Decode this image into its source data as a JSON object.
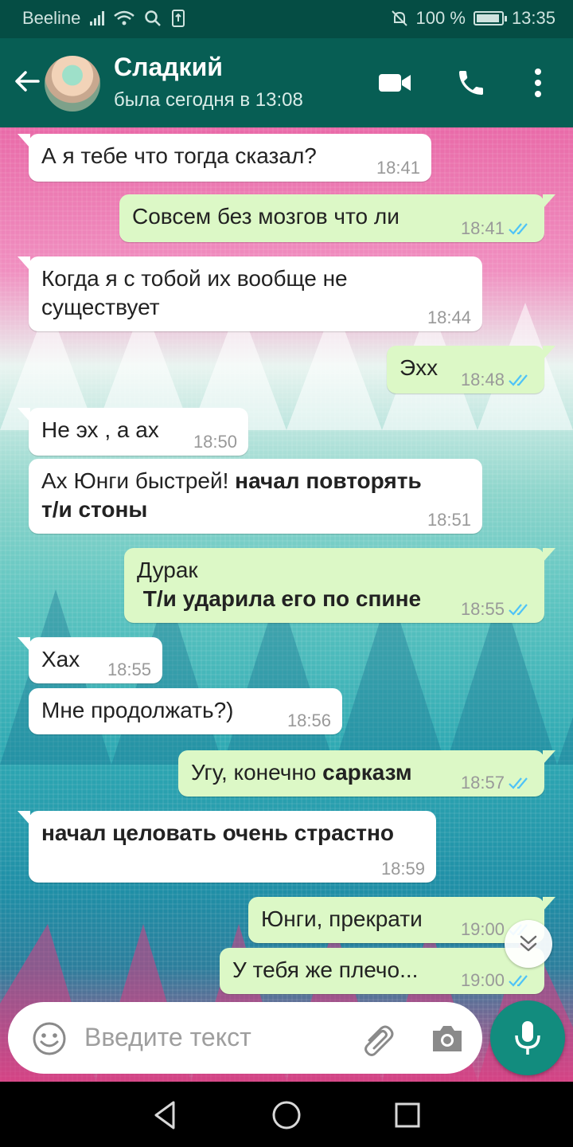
{
  "statusbar": {
    "carrier": "Beeline",
    "battery_text": "100 %",
    "time": "13:35",
    "icons": [
      "signal-icon",
      "wifi-icon",
      "search-icon",
      "sim-icon",
      "mute-icon",
      "battery-icon"
    ]
  },
  "header": {
    "name": "Сладкий",
    "last_seen": "была сегодня в 13:08",
    "icons": [
      "back-arrow-icon",
      "avatar",
      "video-call-icon",
      "phone-icon",
      "more-vert-icon"
    ]
  },
  "messages": [
    {
      "dir": "in",
      "text": "А я тебе что тогда сказал?",
      "time": "18:41"
    },
    {
      "dir": "out",
      "text": "Совсем без мозгов что ли",
      "time": "18:41",
      "read": true
    },
    {
      "dir": "in",
      "text_line1": "Когда я с тобой их вообще не",
      "text_line2": "существует",
      "time": "18:44"
    },
    {
      "dir": "out",
      "text": "Эхх",
      "time": "18:48",
      "read": true
    },
    {
      "dir": "in",
      "text": "Не эх , а ах",
      "time": "18:50"
    },
    {
      "dir": "in",
      "text_plain": "Ах Юнги быстрей! ",
      "text_bold_1": "начал повторять",
      "text_bold_2": "т/и стоны",
      "time": "18:51"
    },
    {
      "dir": "out",
      "text_line1": "Дурак",
      "text_bold": " Т/и ударила его по спине",
      "time": "18:55",
      "read": true
    },
    {
      "dir": "in",
      "text": "Хах",
      "time": "18:55"
    },
    {
      "dir": "in",
      "text": "Мне продолжать?)",
      "time": "18:56"
    },
    {
      "dir": "out",
      "text_plain": "Угу, конечно ",
      "text_bold": "сарказм",
      "time": "18:57",
      "read": true
    },
    {
      "dir": "in",
      "text_bold": "начал целовать очень страстно",
      "time": "18:59"
    },
    {
      "dir": "out",
      "text": "Юнги, прекрати",
      "time": "19:00",
      "read": true
    },
    {
      "dir": "out",
      "text": "У тебя же плечо...",
      "time": "19:00",
      "read": true
    }
  ],
  "input": {
    "placeholder": "Введите текст",
    "icons": [
      "emoji-icon",
      "attach-icon",
      "camera-icon",
      "mic-icon"
    ]
  },
  "colors": {
    "header": "#075e54",
    "statusbar": "#054d44",
    "outgoing_bubble": "#dcf8c6",
    "incoming_bubble": "#ffffff",
    "read_ticks": "#4fc3f7",
    "fab": "#128c7e"
  },
  "navbar": {
    "icons": [
      "back-triangle-icon",
      "home-circle-icon",
      "recents-square-icon"
    ]
  }
}
